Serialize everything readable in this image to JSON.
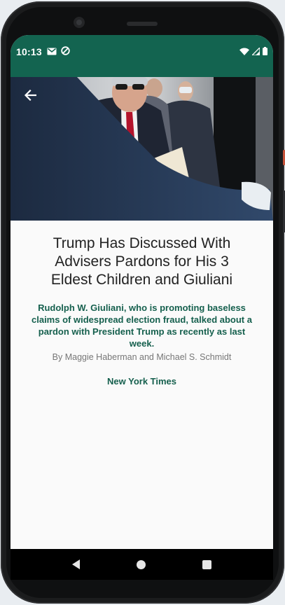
{
  "status_bar": {
    "time": "10:13",
    "left_icons": [
      "gmail-icon",
      "do-not-disturb-icon"
    ],
    "right_icons": [
      "wifi-icon",
      "signal-icon",
      "battery-icon"
    ],
    "color": "#136450"
  },
  "article": {
    "headline": "Trump Has Discussed With Advisers Pardons for His 3 Eldest Children and Giuliani",
    "summary": "Rudolph W. Giuliani, who is promoting baseless claims of widespread election fraud, talked about a pardon with President Trump as recently as last week.",
    "byline": "By Maggie Haberman and Michael S. Schmidt",
    "source": "New York Times",
    "accent_color": "#16604e"
  },
  "hero_image": {
    "icon": "news-photo"
  },
  "toolbar": {
    "back_icon": "arrow-back-icon"
  },
  "navigation": {
    "icons": [
      "nav-back-icon",
      "nav-home-icon",
      "nav-recents-icon"
    ]
  }
}
